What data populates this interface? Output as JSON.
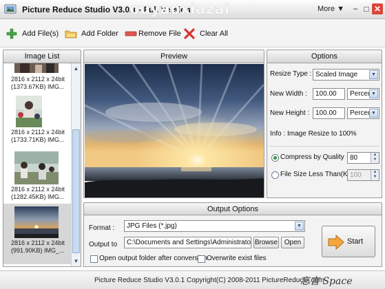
{
  "window": {
    "title": "Picture Reduce Studio V3.0.1  - Full Version",
    "watermark": "ouyaoxiazai",
    "more_menu": "More ▼",
    "minimize": "−",
    "restore": "□",
    "close": "✕"
  },
  "toolbar": {
    "add_files": "Add File(s)",
    "add_folder": "Add Folder",
    "remove_file": "Remove File",
    "clear_all": "Clear All"
  },
  "image_list": {
    "header": "Image List",
    "items": [
      {
        "line1": "2816 x 2112 x 24bit",
        "line2": "(1373.67KB) IMG..."
      },
      {
        "line1": "2816 x 2112 x 24bit",
        "line2": "(1733.71KB) IMG..."
      },
      {
        "line1": "2816 x 2112 x 24bit",
        "line2": "(1282.45KB) IMG..."
      },
      {
        "line1": "2816 x 2112 x 24bit",
        "line2": "(991.90KB) IMG_..."
      }
    ]
  },
  "preview": {
    "header": "Preview"
  },
  "options": {
    "header": "Options",
    "resize_type_label": "Resize Type :",
    "resize_type_value": "Scaled Image",
    "new_width_label": "New Width :",
    "new_width_value": "100.00",
    "new_width_unit": "Percent",
    "new_height_label": "New Height :",
    "new_height_value": "100.00",
    "new_height_unit": "Percent",
    "info": "Info : Image Resize to 100%",
    "compress_label": "Compress by Quality",
    "compress_value": "80",
    "compress_selected": true,
    "filesize_label": "File Size Less Than(KB)",
    "filesize_value": "100",
    "filesize_selected": false
  },
  "output": {
    "header": "Output Options",
    "format_label": "Format :",
    "format_value": "JPG Files (*.jpg)",
    "output_to_label": "Output to",
    "output_path": "C:\\Documents and Settings\\Administrator\\桌面",
    "browse": "Browse",
    "open": "Open",
    "open_after_label": "Open output folder after conversion",
    "open_after_checked": false,
    "overwrite_label": "Overwrite exist files",
    "overwrite_checked": false,
    "start": "Start"
  },
  "statusbar": {
    "copyright": "Picture Reduce Studio V3.0.1 Copyright(C) 2008-2011 PictureReducer.com",
    "signature": "忘言 Space"
  }
}
